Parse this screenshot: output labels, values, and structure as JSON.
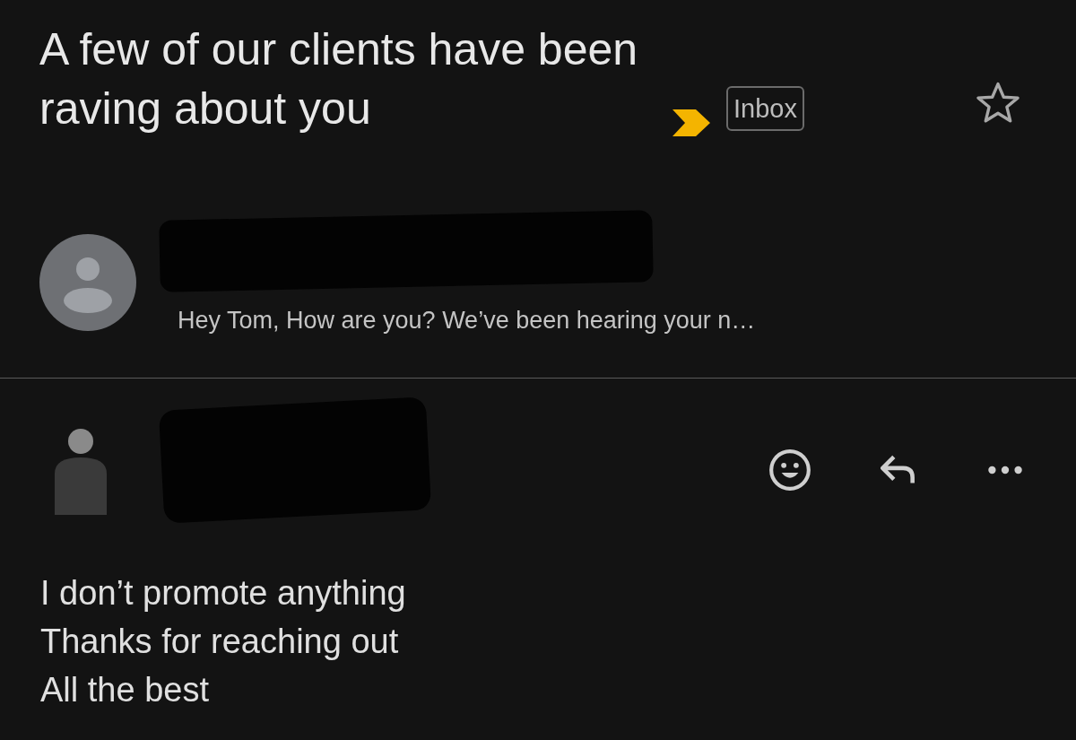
{
  "subject": {
    "title": "A few of our clients have been raving about you",
    "important": true,
    "label": "Inbox",
    "starred": false
  },
  "collapsed_message": {
    "snippet": "Hey Tom, How are you? We’ve been hearing your n…"
  },
  "expanded_message": {
    "body": [
      "I don’t promote anything",
      "Thanks for reaching out",
      "All the best"
    ]
  }
}
